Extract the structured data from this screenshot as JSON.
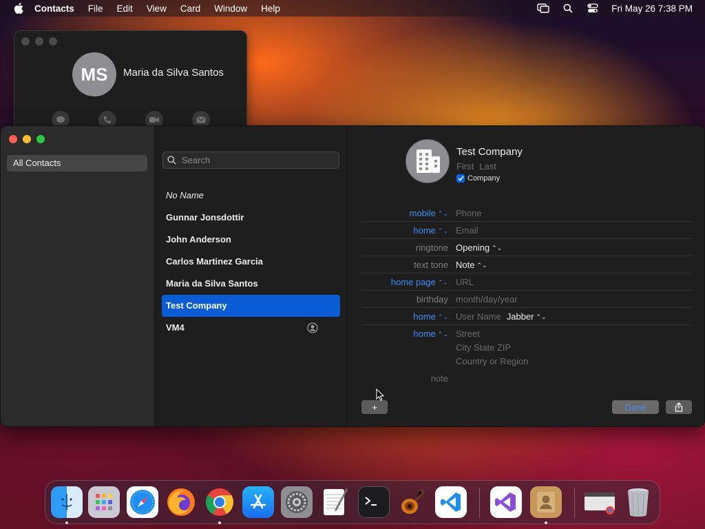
{
  "menubar": {
    "app_name": "Contacts",
    "menus": [
      "File",
      "Edit",
      "View",
      "Card",
      "Window",
      "Help"
    ],
    "clock": "Fri May 26  7:38 PM"
  },
  "mini_card": {
    "initials": "MS",
    "name": "Maria da Silva Santos"
  },
  "sidebar": {
    "items": [
      {
        "label": "All Contacts"
      }
    ]
  },
  "list": {
    "search_placeholder": "Search",
    "contacts": [
      {
        "name": "No Name"
      },
      {
        "name": "Gunnar Jonsdottir"
      },
      {
        "name": "John Anderson"
      },
      {
        "name": "Carlos Martinez Garcia"
      },
      {
        "name": "Maria da Silva Santos"
      },
      {
        "name": "Test Company"
      },
      {
        "name": "VM4"
      }
    ]
  },
  "detail": {
    "company_name": "Test Company",
    "first_placeholder": "First",
    "last_placeholder": "Last",
    "company_checkbox_label": "Company",
    "fields": {
      "mobile": {
        "label": "mobile",
        "placeholder": "Phone"
      },
      "email": {
        "label": "home",
        "placeholder": "Email"
      },
      "ringtone": {
        "label": "ringtone",
        "value": "Opening"
      },
      "texttone": {
        "label": "text tone",
        "value": "Note"
      },
      "homepage": {
        "label": "home page",
        "placeholder": "URL"
      },
      "birthday": {
        "label": "birthday",
        "placeholder": "month/day/year"
      },
      "im": {
        "label": "home",
        "placeholder": "User Name",
        "service": "Jabber"
      },
      "address": {
        "label": "home",
        "street": "Street",
        "city": "City  State  ZIP",
        "country": "Country or Region"
      },
      "note": {
        "label": "note"
      }
    },
    "add_button": "+",
    "done_button": "Done"
  },
  "dock": {
    "apps": [
      "finder-icon",
      "launchpad-icon",
      "safari-icon",
      "firefox-icon",
      "chrome-icon",
      "app-store-icon",
      "system-settings-icon",
      "textedit-icon",
      "terminal-icon",
      "garageband-icon",
      "vscode-icon",
      "visual-studio-icon",
      "contacts-icon",
      "chrome-window-icon",
      "trash-icon"
    ],
    "colors": {
      "selection": "#0a5bd6",
      "accent_blue": "#3b8cf5"
    }
  }
}
